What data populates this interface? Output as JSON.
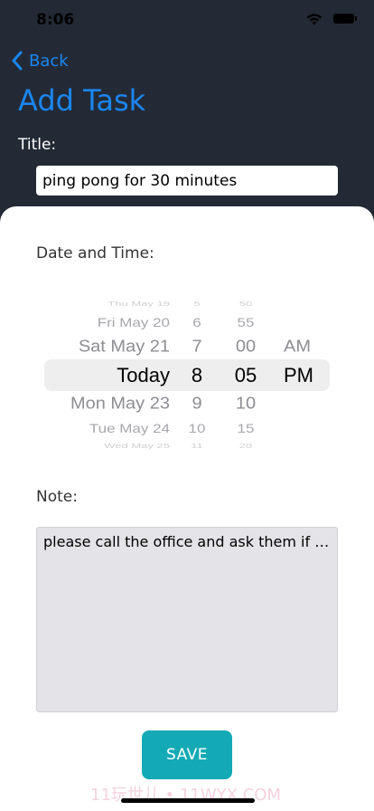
{
  "status_bar": {
    "time": "8:06"
  },
  "nav": {
    "back_label": "Back"
  },
  "page": {
    "title": "Add Task"
  },
  "form": {
    "title_label": "Title:",
    "title_value": "ping pong for 30 minutes",
    "date_label": "Date and Time:",
    "note_label": "Note:",
    "note_value": "please call the office and ask them if yo...",
    "save_label": "SAVE"
  },
  "picker": {
    "dates": [
      "Thu May 19",
      "Fri May 20",
      "Sat May 21",
      "Today",
      "Mon May 23",
      "Tue May 24",
      "Wed May 25"
    ],
    "hours": [
      "5",
      "6",
      "7",
      "8",
      "9",
      "10",
      "11"
    ],
    "minutes": [
      "50",
      "55",
      "00",
      "05",
      "10",
      "15",
      "20"
    ],
    "ampm": [
      "AM",
      "PM"
    ],
    "selected": {
      "date": "Today",
      "hour": "8",
      "minute": "05",
      "ampm": "PM"
    }
  },
  "watermark": "11玩世儿 • 11WYX.COM",
  "colors": {
    "accent": "#1a86f2",
    "header_bg": "#232a36",
    "save_button": "#13aab5",
    "note_bg": "#e4e4e8"
  }
}
